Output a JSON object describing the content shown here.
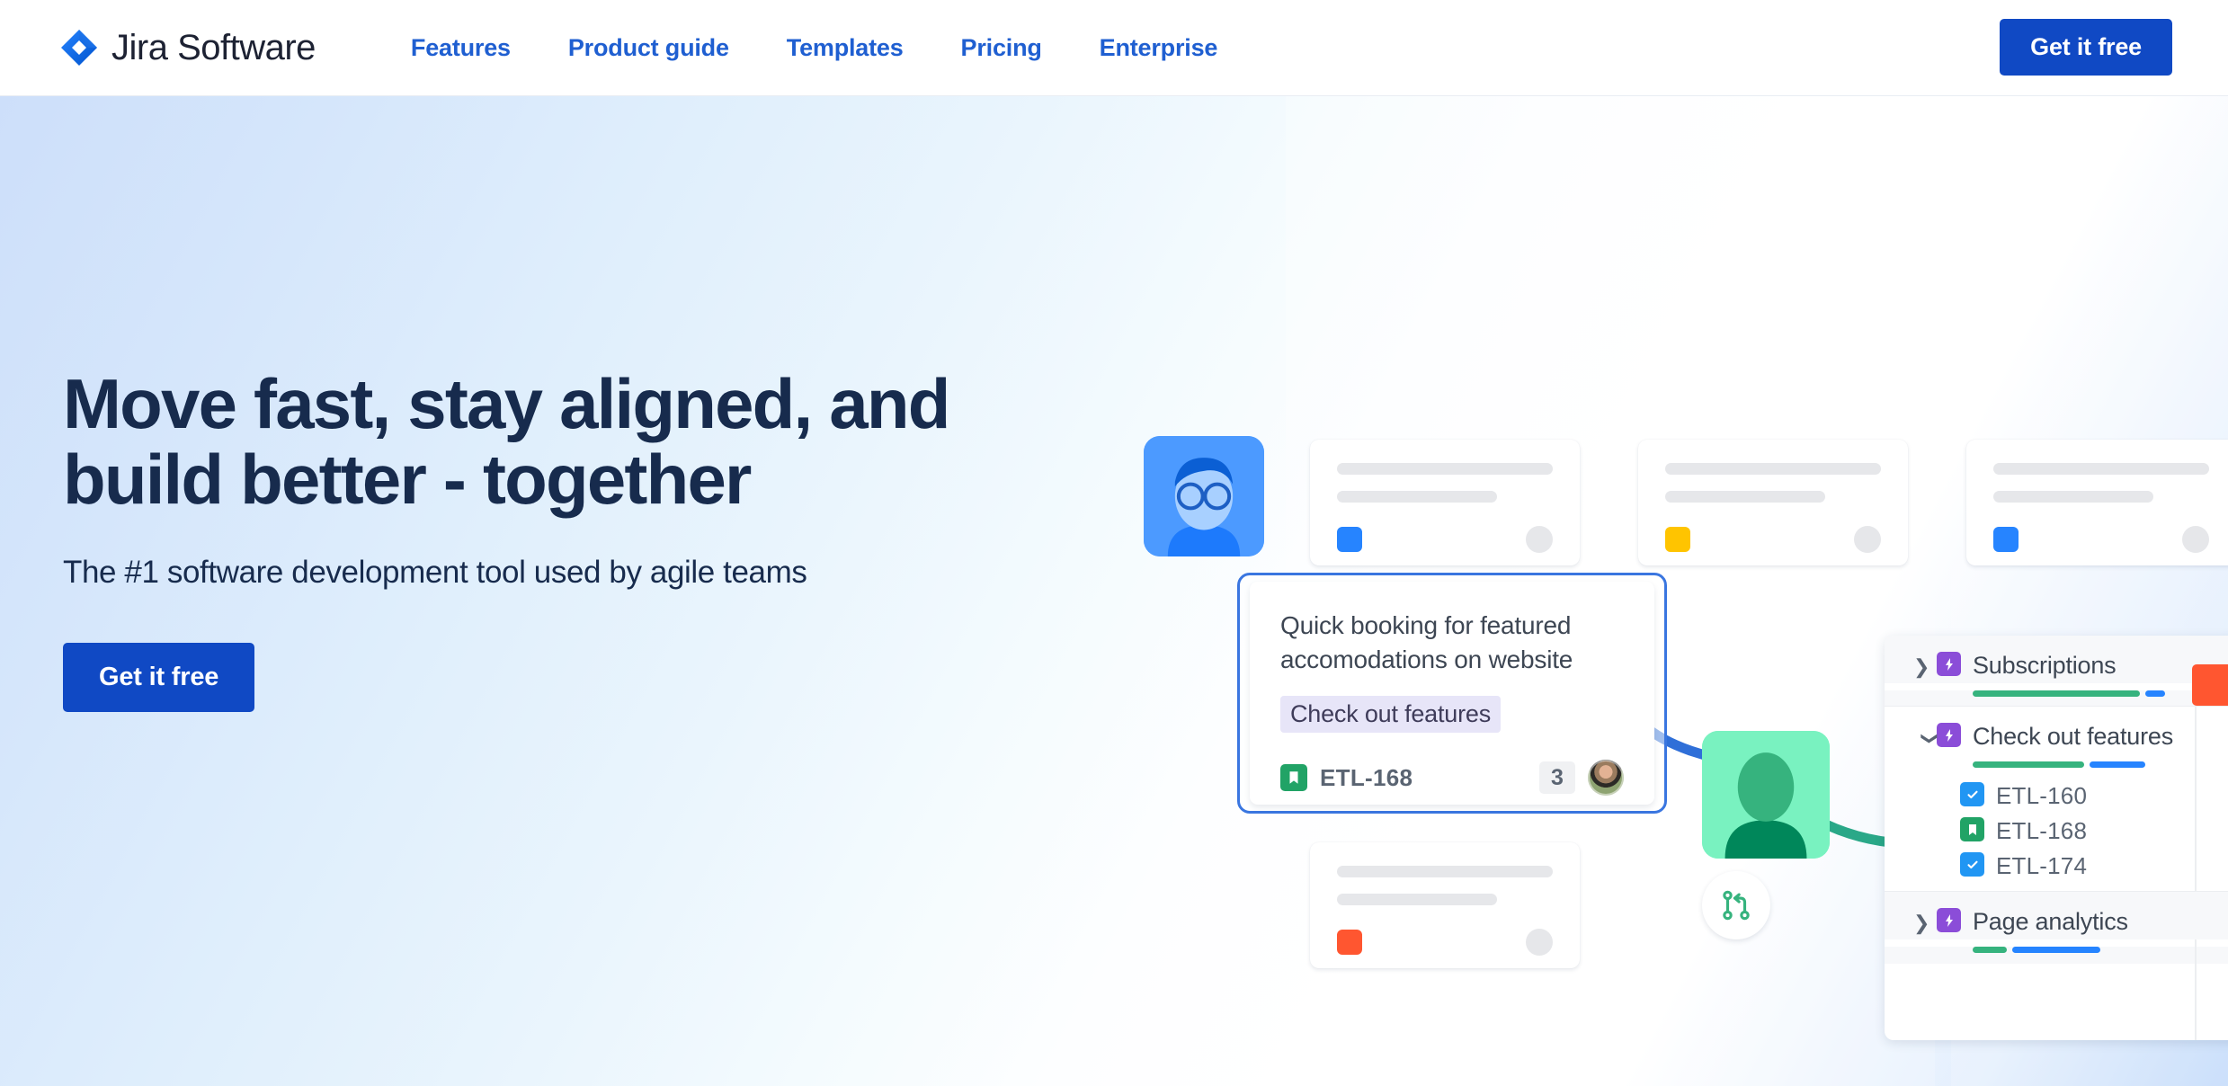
{
  "header": {
    "logo_text": "Jira Software",
    "logo_icon": "jira-diamond-logo",
    "nav": [
      {
        "label": "Features"
      },
      {
        "label": "Product guide"
      },
      {
        "label": "Templates"
      },
      {
        "label": "Pricing"
      },
      {
        "label": "Enterprise"
      }
    ],
    "cta_label": "Get it free"
  },
  "hero": {
    "title_line1": "Move fast, stay aligned, and",
    "title_line2": "build better - together",
    "subtitle": "The #1 software development tool used by agile teams",
    "cta_label": "Get it free"
  },
  "illustration": {
    "main_card": {
      "title": "Quick booking for featured accomodations on website",
      "tag": "Check out features",
      "issue_key": "ETL-168",
      "issue_icon": "story-bookmark-icon",
      "comment_count": "3",
      "avatar": "user-photo-avatar"
    },
    "skeleton_cards": [
      {
        "chip_color": "#2684ff",
        "name": "card-top-left"
      },
      {
        "chip_color": "#ffc400",
        "name": "card-top-middle"
      },
      {
        "chip_color": "#2684ff",
        "name": "card-top-right"
      },
      {
        "chip_color": "#ff5630",
        "name": "card-bottom-left"
      }
    ],
    "avatars": [
      {
        "name": "blue-avatar-tile",
        "color": "#4c9aff"
      },
      {
        "name": "green-avatar-tile",
        "color": "#79f2c0"
      }
    ],
    "branch_icon": "pull-request-branch-icon",
    "tree": [
      {
        "label": "Subscriptions",
        "icon": "epic-bolt-icon",
        "expanded": false,
        "chevron": "chevron-right",
        "progress": {
          "green": 240,
          "blue": 26
        }
      },
      {
        "label": "Check out features",
        "icon": "epic-bolt-icon",
        "expanded": true,
        "chevron": "chevron-down",
        "progress": {
          "green": 140,
          "blue": 66
        },
        "children": [
          {
            "key": "ETL-160",
            "icon": "task-check-icon",
            "color": "#2196f3"
          },
          {
            "key": "ETL-168",
            "icon": "story-bookmark-icon",
            "color": "#21a366"
          },
          {
            "key": "ETL-174",
            "icon": "task-check-icon",
            "color": "#2196f3"
          }
        ]
      },
      {
        "label": "Page analytics",
        "icon": "epic-bolt-icon",
        "expanded": false,
        "chevron": "chevron-right",
        "progress": {
          "green": 40,
          "blue": 98
        }
      }
    ]
  },
  "colors": {
    "brand_blue": "#1049c4",
    "nav_link": "#1f5fd1",
    "heading": "#172b4d",
    "epic_purple": "#8b4dd8",
    "story_green": "#21a366",
    "task_blue": "#2196f3",
    "accent_orange": "#ff5630",
    "accent_yellow": "#ffc400",
    "progress_green": "#36b37e",
    "progress_blue": "#2684ff"
  }
}
